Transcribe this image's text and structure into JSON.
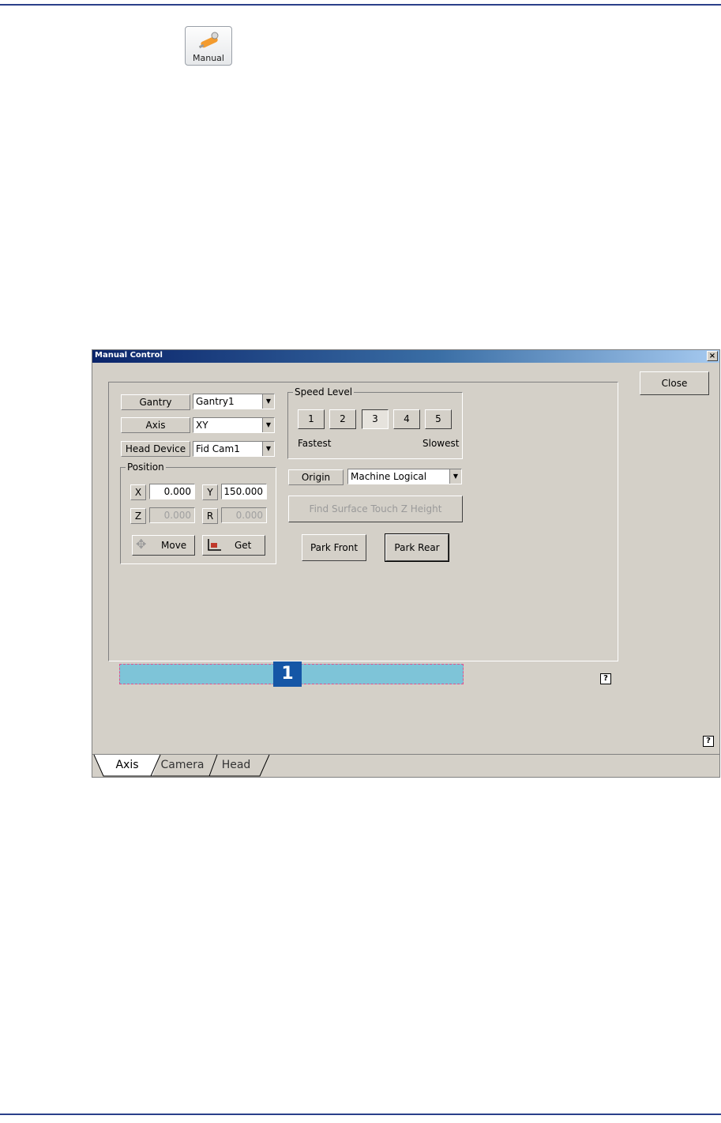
{
  "toolbar": {
    "manual_label": "Manual"
  },
  "dialog": {
    "title": "Manual Control",
    "close_label": "Close",
    "gantry": {
      "label": "Gantry",
      "value": "Gantry1"
    },
    "axis": {
      "label": "Axis",
      "value": "XY"
    },
    "head_device": {
      "label": "Head Device",
      "value": "Fid Cam1"
    },
    "position": {
      "legend": "Position",
      "x_label": "X",
      "x_value": "0.000",
      "y_label": "Y",
      "y_value": "150.000",
      "z_label": "Z",
      "z_value": "0.000",
      "r_label": "R",
      "r_value": "0.000",
      "move_label": "Move",
      "get_label": "Get"
    },
    "speed": {
      "legend": "Speed Level",
      "levels": [
        "1",
        "2",
        "3",
        "4",
        "5"
      ],
      "selected": "3",
      "fastest": "Fastest",
      "slowest": "Slowest"
    },
    "origin": {
      "label": "Origin",
      "value": "Machine Logical"
    },
    "find_surface_label": "Find Surface Touch Z Height",
    "park_front_label": "Park Front",
    "park_rear_label": "Park Rear",
    "status_badge": "1",
    "help_label": "?",
    "tabs": [
      "Axis",
      "Camera",
      "Head"
    ]
  },
  "colors": {
    "title_start": "#0a246a",
    "title_end": "#a6caf0",
    "status_bar": "#7ec4d8",
    "badge": "#1556a6"
  }
}
